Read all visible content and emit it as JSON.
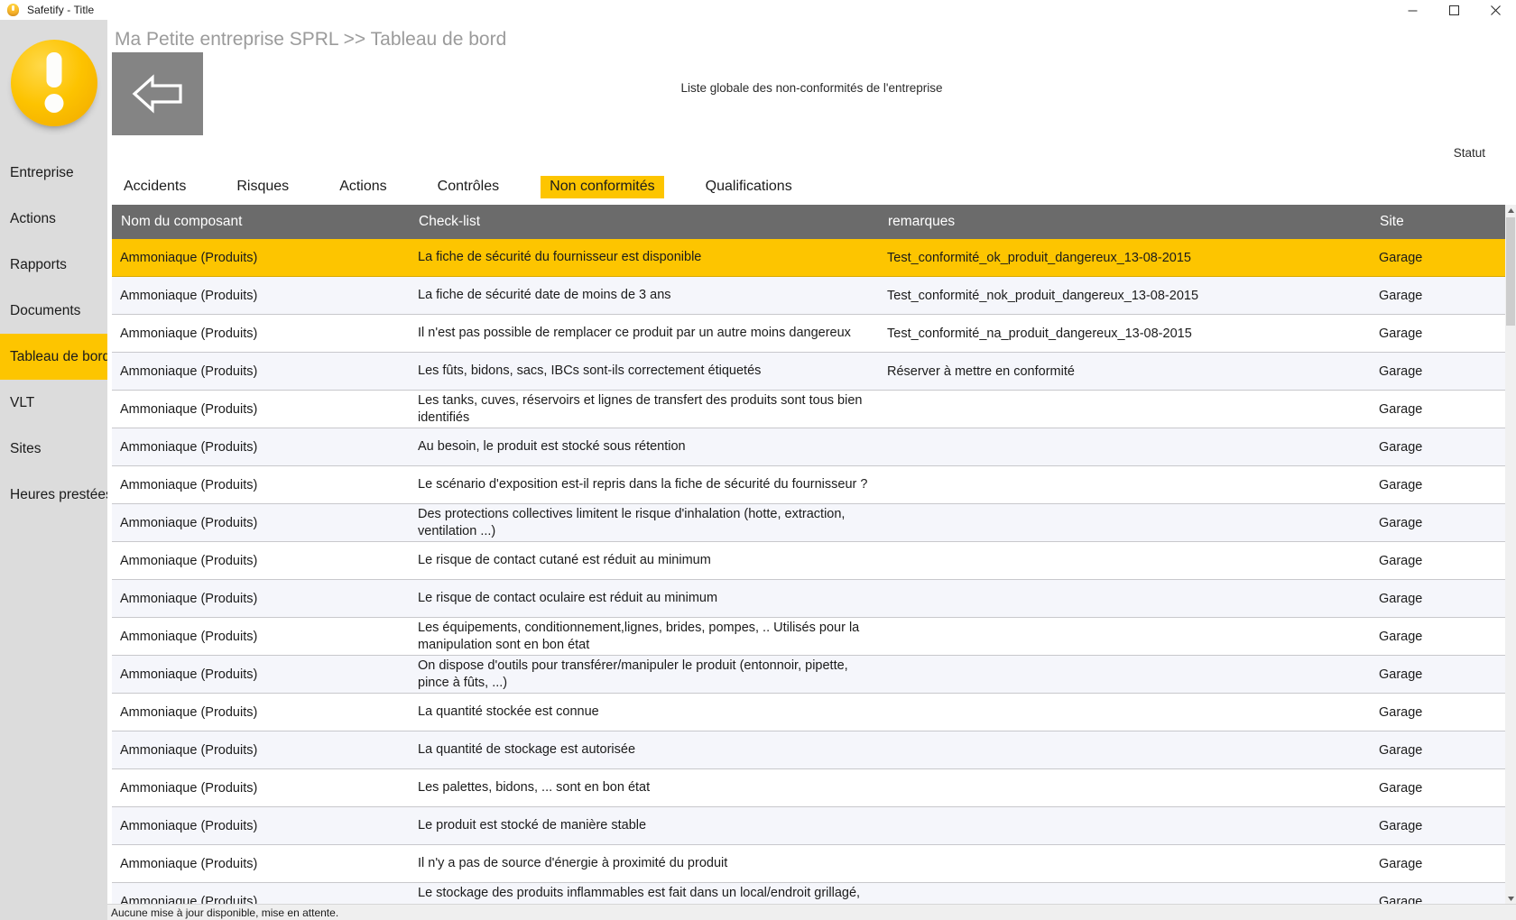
{
  "window": {
    "title": "Safetify - Title",
    "icon": "bulb-icon",
    "controls": {
      "minimize": "minimize-icon",
      "maximize": "maximize-icon",
      "close": "close-icon"
    }
  },
  "sidebar": {
    "logo": "safetify-exclamation-logo",
    "items": [
      {
        "label": "Entreprise",
        "active": false
      },
      {
        "label": "Actions",
        "active": false
      },
      {
        "label": "Rapports",
        "active": false
      },
      {
        "label": "Documents",
        "active": false
      },
      {
        "label": "Tableau de bord",
        "active": true
      },
      {
        "label": "VLT",
        "active": false
      },
      {
        "label": "Sites",
        "active": false
      },
      {
        "label": "Heures prestées",
        "active": false
      }
    ]
  },
  "header": {
    "breadcrumb": "Ma Petite entreprise SPRL >> Tableau de bord",
    "back_icon": "back-arrow-icon",
    "global_title": "Liste globale des non-conformités de l'entreprise",
    "statut_label": "Statut"
  },
  "tabs": [
    {
      "label": "Accidents",
      "active": false
    },
    {
      "label": "Risques",
      "active": false
    },
    {
      "label": "Actions",
      "active": false
    },
    {
      "label": "Contrôles",
      "active": false
    },
    {
      "label": "Non conformités",
      "active": true
    },
    {
      "label": "Qualifications",
      "active": false
    }
  ],
  "table": {
    "columns": [
      "Nom du composant",
      "Check-list",
      "remarques",
      "Site"
    ],
    "rows": [
      {
        "name": "Ammoniaque (Produits)",
        "checklist": "La fiche de sécurité du fournisseur est disponible",
        "remarks": "Test_conformité_ok_produit_dangereux_13-08-2015",
        "site": "Garage",
        "selected": true
      },
      {
        "name": "Ammoniaque (Produits)",
        "checklist": "La fiche de sécurité date de moins de 3 ans",
        "remarks": "Test_conformité_nok_produit_dangereux_13-08-2015",
        "site": "Garage",
        "selected": false
      },
      {
        "name": "Ammoniaque (Produits)",
        "checklist": "Il n'est pas possible de remplacer ce produit par un autre moins dangereux",
        "remarks": "Test_conformité_na_produit_dangereux_13-08-2015",
        "site": "Garage",
        "selected": false
      },
      {
        "name": "Ammoniaque (Produits)",
        "checklist": "Les fûts, bidons, sacs, IBCs sont-ils correctement étiquetés",
        "remarks": "Réserver à mettre en conformité",
        "site": "Garage",
        "selected": false
      },
      {
        "name": "Ammoniaque (Produits)",
        "checklist": "Les tanks, cuves, réservoirs et lignes de transfert des produits sont tous bien identifiés",
        "remarks": "",
        "site": "Garage",
        "selected": false
      },
      {
        "name": "Ammoniaque (Produits)",
        "checklist": "Au besoin, le produit est stocké sous rétention",
        "remarks": "",
        "site": "Garage",
        "selected": false
      },
      {
        "name": "Ammoniaque (Produits)",
        "checklist": "Le scénario d'exposition est-il repris dans la fiche de sécurité du fournisseur ?",
        "remarks": "",
        "site": "Garage",
        "selected": false
      },
      {
        "name": "Ammoniaque (Produits)",
        "checklist": "Des protections collectives limitent le risque d'inhalation (hotte, extraction, ventilation ...)",
        "remarks": "",
        "site": "Garage",
        "selected": false
      },
      {
        "name": "Ammoniaque (Produits)",
        "checklist": "Le risque de contact cutané est réduit au minimum",
        "remarks": "",
        "site": "Garage",
        "selected": false
      },
      {
        "name": "Ammoniaque (Produits)",
        "checklist": "Le risque de contact oculaire est réduit au minimum",
        "remarks": "",
        "site": "Garage",
        "selected": false
      },
      {
        "name": "Ammoniaque (Produits)",
        "checklist": "Les équipements, conditionnement,lignes, brides, pompes, .. Utilisés pour la manipulation sont en bon état",
        "remarks": "",
        "site": "Garage",
        "selected": false
      },
      {
        "name": "Ammoniaque (Produits)",
        "checklist": "On dispose d'outils pour transférer/manipuler le produit (entonnoir, pipette, pince à fûts, ...)",
        "remarks": "",
        "site": "Garage",
        "selected": false
      },
      {
        "name": "Ammoniaque (Produits)",
        "checklist": "La quantité stockée est connue",
        "remarks": "",
        "site": "Garage",
        "selected": false
      },
      {
        "name": "Ammoniaque (Produits)",
        "checklist": "La quantité de stockage est autorisée",
        "remarks": "",
        "site": "Garage",
        "selected": false
      },
      {
        "name": "Ammoniaque (Produits)",
        "checklist": "Les palettes, bidons, ... sont en bon état",
        "remarks": "",
        "site": "Garage",
        "selected": false
      },
      {
        "name": "Ammoniaque (Produits)",
        "checklist": "Le produit est stocké de manière stable",
        "remarks": "",
        "site": "Garage",
        "selected": false
      },
      {
        "name": "Ammoniaque (Produits)",
        "checklist": "Il n'y a pas de source d'énergie à proximité du produit",
        "remarks": "",
        "site": "Garage",
        "selected": false
      },
      {
        "name": "Ammoniaque (Produits)",
        "checklist": "Le stockage des produits inflammables est fait dans un local/endroit grillagé, cadenassé, soumis à autorisation",
        "remarks": "",
        "site": "Garage",
        "selected": false
      }
    ]
  },
  "scrollbar": {
    "up_arrow": "chevron-up-icon",
    "down_arrow": "chevron-down-icon"
  },
  "statusbar": {
    "message": "Aucune mise à jour disponible, mise en attente."
  },
  "colors": {
    "accent": "#fdc500",
    "header_gray": "#6b6b6b",
    "sidebar_gray": "#dcdcdc",
    "back_gray": "#848484",
    "row_alt": "#f5f6fb"
  }
}
